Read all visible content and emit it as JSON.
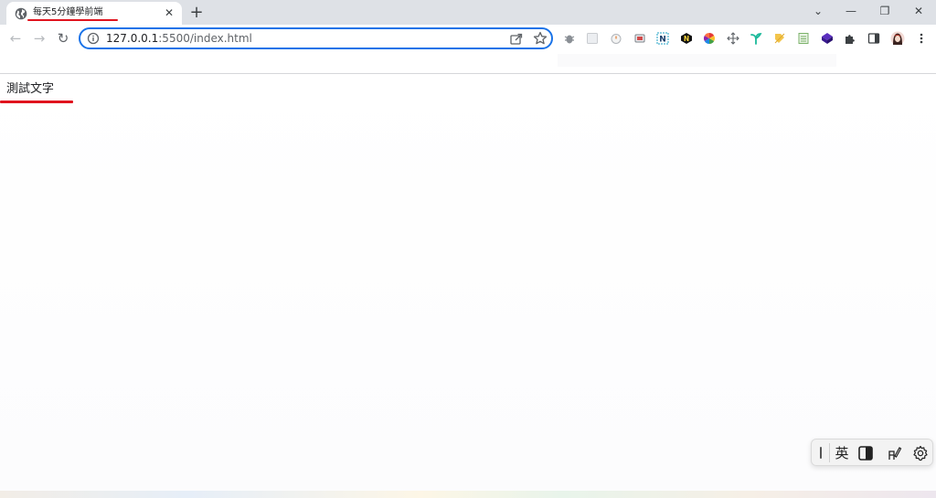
{
  "tab": {
    "title": "每天5分鐘學前端",
    "close_glyph": "✕",
    "new_tab_glyph": "+"
  },
  "window_controls": {
    "dropdown": "⌄",
    "minimize": "—",
    "restore": "❐",
    "close": "✕"
  },
  "nav": {
    "back": "←",
    "forward": "→",
    "reload": "↻"
  },
  "address": {
    "host": "127.0.0.1",
    "path": ":5500/index.html"
  },
  "extensions": [
    "bug-icon",
    "square-icon",
    "timer-icon",
    "screenshot-icon",
    "notion-icon",
    "n-badge-icon",
    "color-wheel-icon",
    "move-icon",
    "bird-icon",
    "tag-icon",
    "sheet-icon",
    "cube-icon",
    "puzzle-icon",
    "sidepanel-icon",
    "profile-avatar"
  ],
  "page": {
    "text": "測試文字"
  },
  "ime": {
    "mode": "英"
  },
  "colors": {
    "accent_underline": "#e0141e",
    "omnibox_border": "#1a73e8",
    "tabstrip": "#dee1e6"
  }
}
